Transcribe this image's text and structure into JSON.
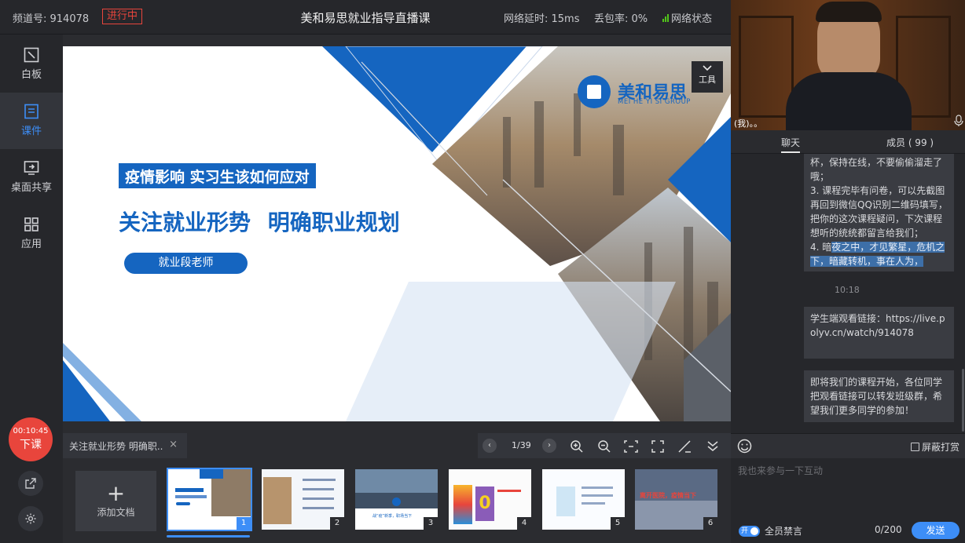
{
  "topbar": {
    "channel": "频道号: 914078",
    "status": "进行中",
    "title": "美和易思就业指导直播课",
    "latency": "网络延时: 15ms",
    "loss": "丢包率: 0%",
    "net_status": "网络状态"
  },
  "nav": {
    "whiteboard": "白板",
    "courseware": "课件",
    "screen_share": "桌面共享",
    "apps": "应用"
  },
  "end_class": {
    "timer": "00:10:45",
    "label": "下课"
  },
  "slide": {
    "logo_cn": "美和易思",
    "logo_en": "MEI HE YI SI GROUP",
    "banner": "疫情影响 实习生该如何应对",
    "headline": "关注就业形势 明确职业规划",
    "teacher": "就业段老师",
    "tool": "工具"
  },
  "docbar": {
    "tab": "关注就业形势 明确职..",
    "page": "1/39",
    "add_doc": "添加文档",
    "thumb_nums": [
      "1",
      "2",
      "3",
      "4",
      "5",
      "6"
    ],
    "thumb3_text": "战“疫”新季，职场当下",
    "thumb6_text": "离开医院，疫情当下"
  },
  "video": {
    "self_label": "(我)。。"
  },
  "chat": {
    "tab_chat": "聊天",
    "tab_members": "成员 ( 99 )",
    "msg1_a": "杯，保持在线，不要偷偷溜走了哦；",
    "msg1_b": "3. 课程完毕有问卷，可以先截图再回到微信QQ识别二维码填写，把你的这次课程疑问，下次课程想听的统统都留言给我们；",
    "msg1_c_plain": "4. 暗",
    "msg1_c_hl": "夜之中，才见繁星，危机之下，暗藏转机，事在人为，",
    "time": "10:18",
    "msg2": "学生端观看链接：https://live.polyv.cn/watch/914078",
    "msg3": "即将我们的课程开始，各位同学把观看链接可以转发班级群，希望我们更多同学的参加！",
    "shield": "屏蔽打赏",
    "placeholder": "我也来参与一下互动",
    "toggle": "开",
    "mute_all": "全员禁言",
    "count": "0/200",
    "send": "发送"
  },
  "colors": {
    "accent": "#3d8ef7",
    "live_red": "#e8453c",
    "slide_blue": "#1565c0"
  }
}
